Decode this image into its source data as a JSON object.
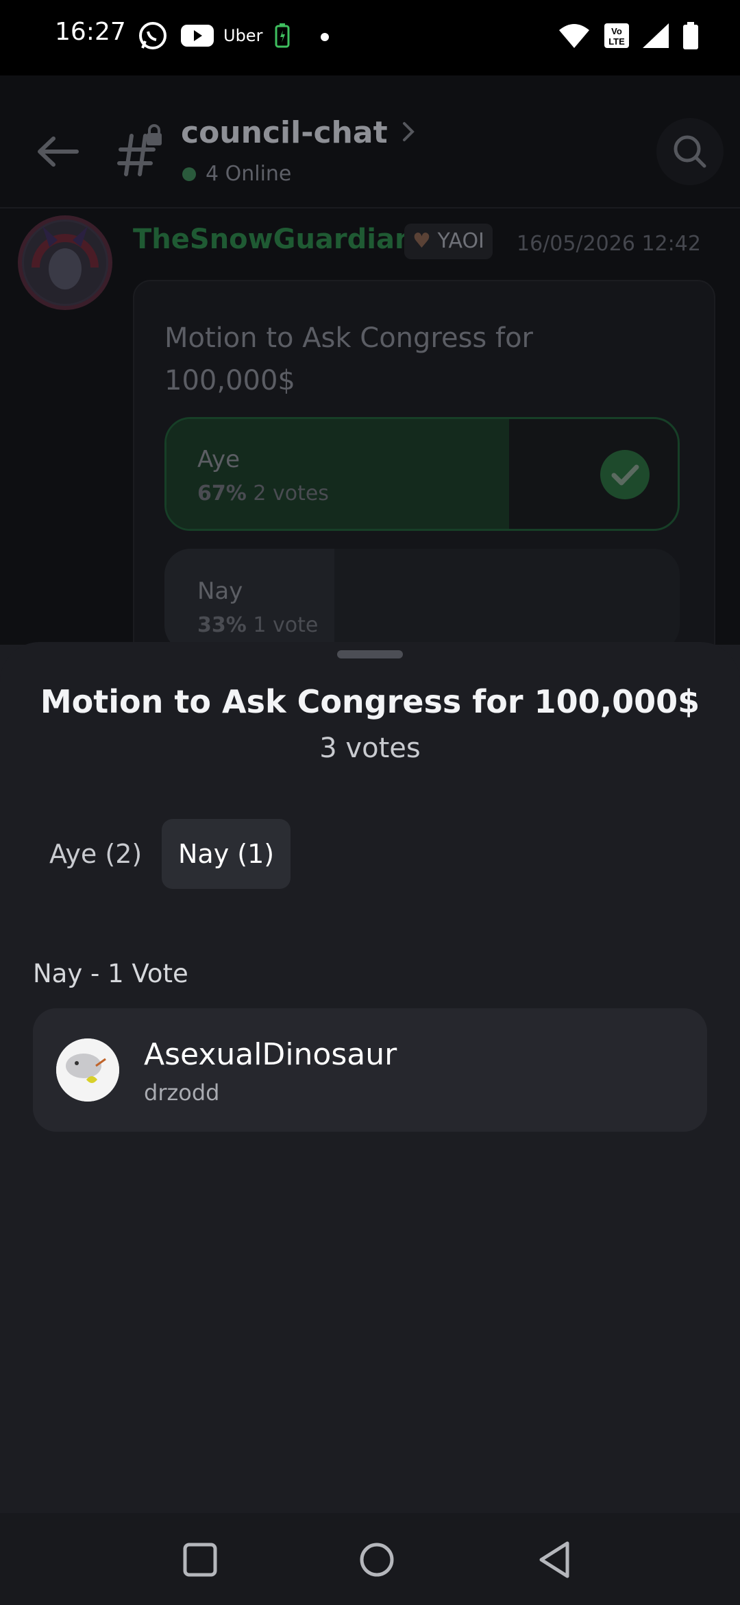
{
  "status_bar": {
    "time": "16:27",
    "uber": "Uber",
    "icons": [
      "whatsapp-icon",
      "youtube-icon",
      "battery-saver-icon",
      "dot-icon",
      "wifi-icon",
      "volte-icon",
      "signal-icon",
      "battery-icon"
    ]
  },
  "channel": {
    "name": "council-chat",
    "online": "4 Online",
    "icons": [
      "back-arrow-icon",
      "hash-lock-icon",
      "chevron-right-icon",
      "search-icon"
    ]
  },
  "message": {
    "author": "TheSnowGuardian",
    "tag": "YAOI",
    "timestamp": "16/05/2026 12:42",
    "poll": {
      "question": "Motion to Ask Congress for 100,000$",
      "options": [
        {
          "label": "Aye",
          "percent": "67%",
          "votes": "2 votes",
          "fraction": 0.67,
          "selected": true
        },
        {
          "label": "Nay",
          "percent": "33%",
          "votes": "1 vote",
          "fraction": 0.33,
          "selected": false
        }
      ]
    }
  },
  "sheet": {
    "title": "Motion to Ask Congress for 100,000$",
    "subtitle": "3 votes",
    "tabs": [
      {
        "label": "Aye (2)",
        "active": false
      },
      {
        "label": "Nay (1)",
        "active": true
      }
    ],
    "section": "Nay - 1 Vote",
    "voters": [
      {
        "display_name": "AsexualDinosaur",
        "username": "drzodd"
      }
    ]
  },
  "nav": {
    "icons": [
      "recents-square-icon",
      "home-circle-icon",
      "back-triangle-icon"
    ]
  },
  "colors": {
    "accent_green": "#23a559",
    "sheet_bg": "#1c1d22",
    "card_bg": "#26272d"
  }
}
